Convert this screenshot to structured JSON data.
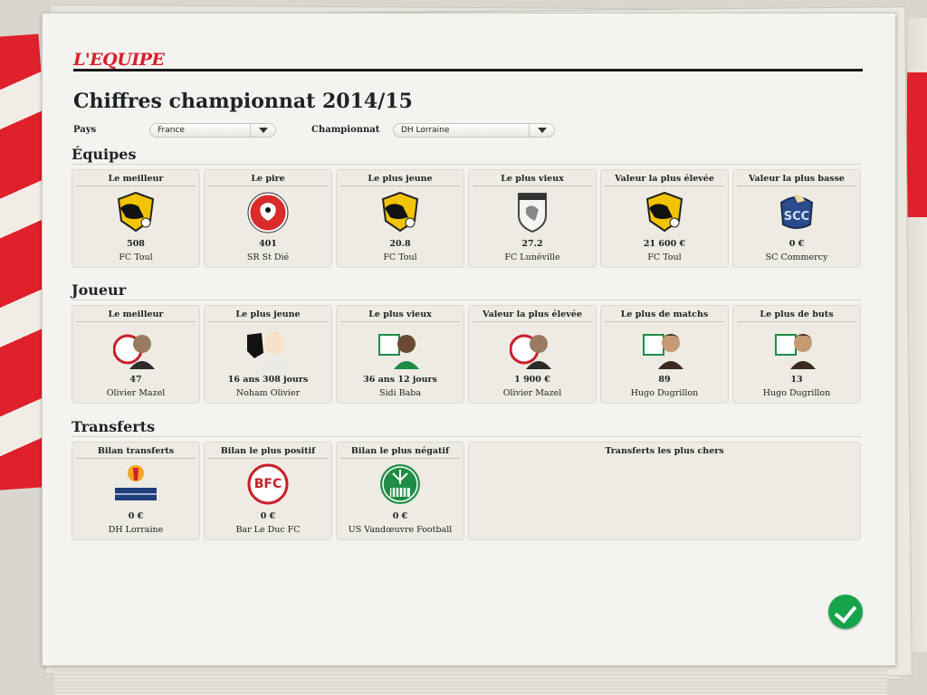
{
  "header": {
    "logo": "L'EQUIPE",
    "title": "Chiffres championnat 2014/15"
  },
  "filters": {
    "country_label": "Pays",
    "country_value": "France",
    "league_label": "Championnat",
    "league_value": "DH Lorraine"
  },
  "sections": {
    "teams": {
      "title": "Équipes",
      "cards": [
        {
          "title": "Le meilleur",
          "value": "508",
          "name": "FC Toul",
          "icon": "fc-toul-crest-icon"
        },
        {
          "title": "Le pire",
          "value": "401",
          "name": "SR St Dié",
          "icon": "sr-st-die-crest-icon"
        },
        {
          "title": "Le plus jeune",
          "value": "20.8",
          "name": "FC Toul",
          "icon": "fc-toul-crest-icon"
        },
        {
          "title": "Le plus vieux",
          "value": "27.2",
          "name": "FC Lunéville",
          "icon": "fc-luneville-crest-icon"
        },
        {
          "title": "Valeur la plus élevée",
          "value": "21 600 €",
          "name": "FC Toul",
          "icon": "fc-toul-crest-icon"
        },
        {
          "title": "Valeur la plus basse",
          "value": "0 €",
          "name": "SC Commercy",
          "icon": "sc-commercy-crest-icon"
        }
      ]
    },
    "players": {
      "title": "Joueur",
      "cards": [
        {
          "title": "Le meilleur",
          "value": "47",
          "name": "Olivier Mazel",
          "icon": "player-portrait-icon"
        },
        {
          "title": "Le plus jeune",
          "value": "16 ans 308 jours",
          "name": "Noham Olivier",
          "icon": "player-portrait-icon"
        },
        {
          "title": "Le plus vieux",
          "value": "36 ans 12 jours",
          "name": "Sidi Baba",
          "icon": "player-portrait-icon"
        },
        {
          "title": "Valeur la plus élevée",
          "value": "1 900 €",
          "name": "Olivier Mazel",
          "icon": "player-portrait-icon"
        },
        {
          "title": "Le plus de matchs",
          "value": "89",
          "name": "Hugo Dugrillon",
          "icon": "player-portrait-icon"
        },
        {
          "title": "Le plus de buts",
          "value": "13",
          "name": "Hugo Dugrillon",
          "icon": "player-portrait-icon"
        }
      ]
    },
    "transfers": {
      "title": "Transferts",
      "cards": [
        {
          "title": "Bilan transferts",
          "value": "0 €",
          "name": "DH Lorraine",
          "icon": "league-logo-icon"
        },
        {
          "title": "Bilan le plus positif",
          "value": "0 €",
          "name": "Bar Le Duc FC",
          "icon": "bar-le-duc-crest-icon"
        },
        {
          "title": "Bilan le plus négatif",
          "value": "0 €",
          "name": "US Vandœuvre Football",
          "icon": "us-vandoeuvre-crest-icon"
        }
      ],
      "expensive_title": "Transferts les plus chers"
    }
  },
  "colors": {
    "accent_red": "#d6202a",
    "confirm_green": "#17a34a",
    "paper": "#f4f3f0",
    "card": "#eeebe4"
  }
}
